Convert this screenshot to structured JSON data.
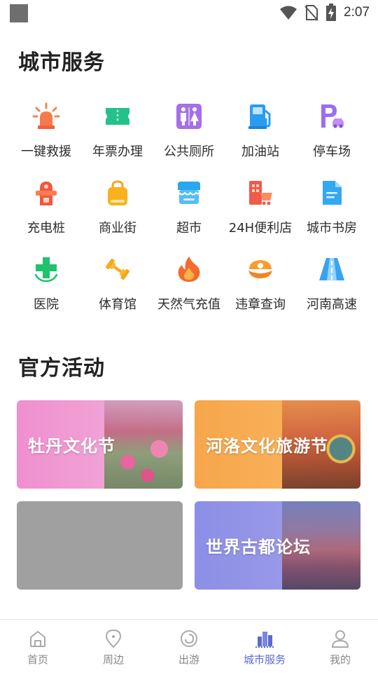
{
  "status_bar": {
    "time": "2:07"
  },
  "services": {
    "title": "城市服务",
    "items": [
      {
        "label": "一键救援",
        "icon": "siren-icon"
      },
      {
        "label": "年票办理",
        "icon": "ticket-icon"
      },
      {
        "label": "公共厕所",
        "icon": "restroom-icon"
      },
      {
        "label": "加油站",
        "icon": "fuel-pump-icon"
      },
      {
        "label": "停车场",
        "icon": "parking-icon"
      },
      {
        "label": "充电桩",
        "icon": "charging-pile-icon"
      },
      {
        "label": "商业街",
        "icon": "shopping-bag-icon"
      },
      {
        "label": "超市",
        "icon": "store-icon"
      },
      {
        "label": "24H便利店",
        "icon": "convenience-store-icon"
      },
      {
        "label": "城市书房",
        "icon": "document-icon"
      },
      {
        "label": "医院",
        "icon": "hospital-cross-icon"
      },
      {
        "label": "体育馆",
        "icon": "dumbbell-icon"
      },
      {
        "label": "天然气充值",
        "icon": "flame-icon"
      },
      {
        "label": "违章查询",
        "icon": "police-cap-icon"
      },
      {
        "label": "河南高速",
        "icon": "highway-icon"
      }
    ]
  },
  "activities": {
    "title": "官方活动",
    "cards": [
      {
        "label": "牡丹文化节"
      },
      {
        "label": "河洛文化旅游节"
      },
      {
        "label": ""
      },
      {
        "label": "世界古都论坛"
      }
    ]
  },
  "tabbar": {
    "tabs": [
      {
        "label": "首页",
        "icon": "home-icon"
      },
      {
        "label": "周边",
        "icon": "location-pin-icon"
      },
      {
        "label": "出游",
        "icon": "swirl-icon"
      },
      {
        "label": "城市服务",
        "icon": "city-buildings-icon",
        "active": true
      },
      {
        "label": "我的",
        "icon": "user-icon"
      }
    ]
  },
  "colors": {
    "accent": "#5b6ad0"
  }
}
